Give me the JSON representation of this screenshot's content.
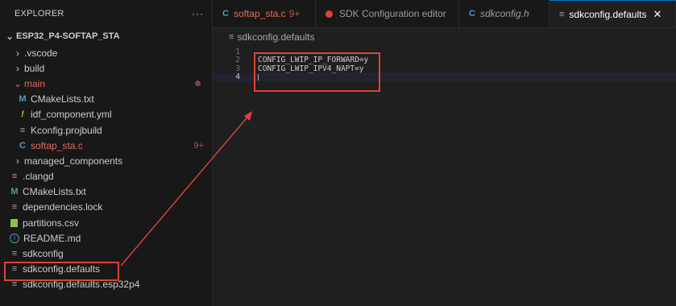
{
  "sidebar": {
    "title": "EXPLORER",
    "more": "···",
    "project": "ESP32_P4-SOFTAP_STA",
    "items": [
      {
        "label": ".vscode"
      },
      {
        "label": "build"
      },
      {
        "label": "main"
      },
      {
        "label": "CMakeLists.txt"
      },
      {
        "label": "idf_component.yml"
      },
      {
        "label": "Kconfig.projbuild"
      },
      {
        "label": "softap_sta.c",
        "badge": "9+"
      },
      {
        "label": "managed_components"
      },
      {
        "label": ".clangd"
      },
      {
        "label": "CMakeLists.txt"
      },
      {
        "label": "dependencies.lock"
      },
      {
        "label": "partitions.csv"
      },
      {
        "label": "README.md"
      },
      {
        "label": "sdkconfig"
      },
      {
        "label": "sdkconfig.defaults"
      },
      {
        "label": "sdkconfig.defaults.esp32p4"
      }
    ]
  },
  "tabs": [
    {
      "label": "softap_sta.c",
      "modified": "9+"
    },
    {
      "label": "SDK Configuration editor"
    },
    {
      "label": "sdkconfig.h"
    },
    {
      "label": "sdkconfig.defaults",
      "close": "✕"
    }
  ],
  "breadcrumb": "sdkconfig.defaults",
  "editor": {
    "lines": [
      {
        "n": "1",
        "text": ""
      },
      {
        "n": "2",
        "text": "CONFIG_LWIP_IP_FORWARD=y"
      },
      {
        "n": "3",
        "text": "CONFIG_LWIP_IPV4_NAPT=y"
      },
      {
        "n": "4",
        "text": ""
      }
    ]
  },
  "colors": {
    "annotation": "#e0413a",
    "accent": "#0078d4",
    "modified": "#c0504d"
  }
}
